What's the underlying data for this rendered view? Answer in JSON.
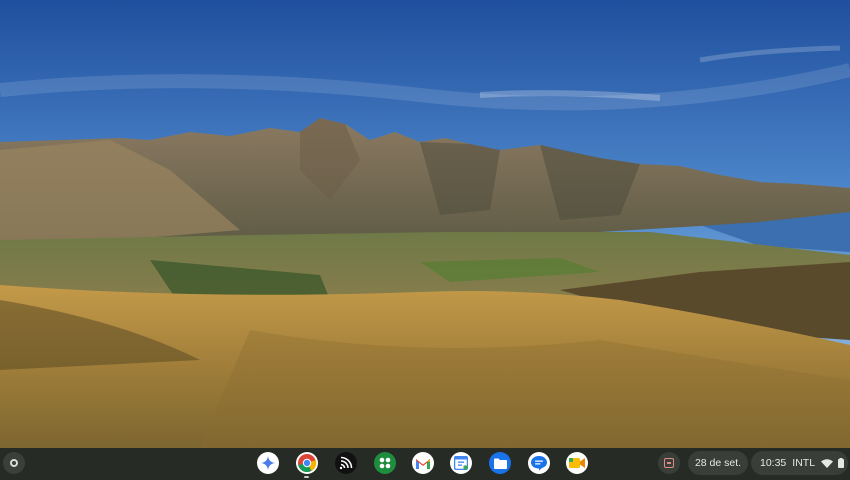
{
  "shelf": {
    "launcher_icon": "launcher-circle-icon",
    "apps": [
      {
        "name": "Gemini",
        "icon": "gemini-star-icon",
        "color": "#4b7bec"
      },
      {
        "name": "Chrome",
        "icon": "chrome-icon",
        "color": "#1a73e8",
        "running": true
      },
      {
        "name": "Cast",
        "icon": "cast-icon",
        "color": "#111111"
      },
      {
        "name": "Play Store Apps",
        "icon": "apps-grid-icon",
        "color": "#1e8e3e"
      },
      {
        "name": "Gmail",
        "icon": "gmail-icon",
        "color": "#ea4335"
      },
      {
        "name": "Calendar",
        "icon": "calendar-icon",
        "color": "#4285f4"
      },
      {
        "name": "Files",
        "icon": "files-folder-icon",
        "color": "#1a73e8"
      },
      {
        "name": "Messages",
        "icon": "messages-icon",
        "color": "#1a73e8"
      },
      {
        "name": "Meet",
        "icon": "meet-camera-icon",
        "color": "#fbbc04"
      }
    ],
    "holding_space_icon": "holding-space-icon"
  },
  "tray": {
    "date": "28 de set.",
    "time": "10:35",
    "ime": "INTL",
    "wifi_icon": "wifi-icon",
    "battery_icon": "battery-icon"
  },
  "colors": {
    "shelf_bg": "#272b26",
    "pill_bg": "#3a3e39",
    "sky_top": "#2458a8",
    "grass": "#b08a3c"
  }
}
